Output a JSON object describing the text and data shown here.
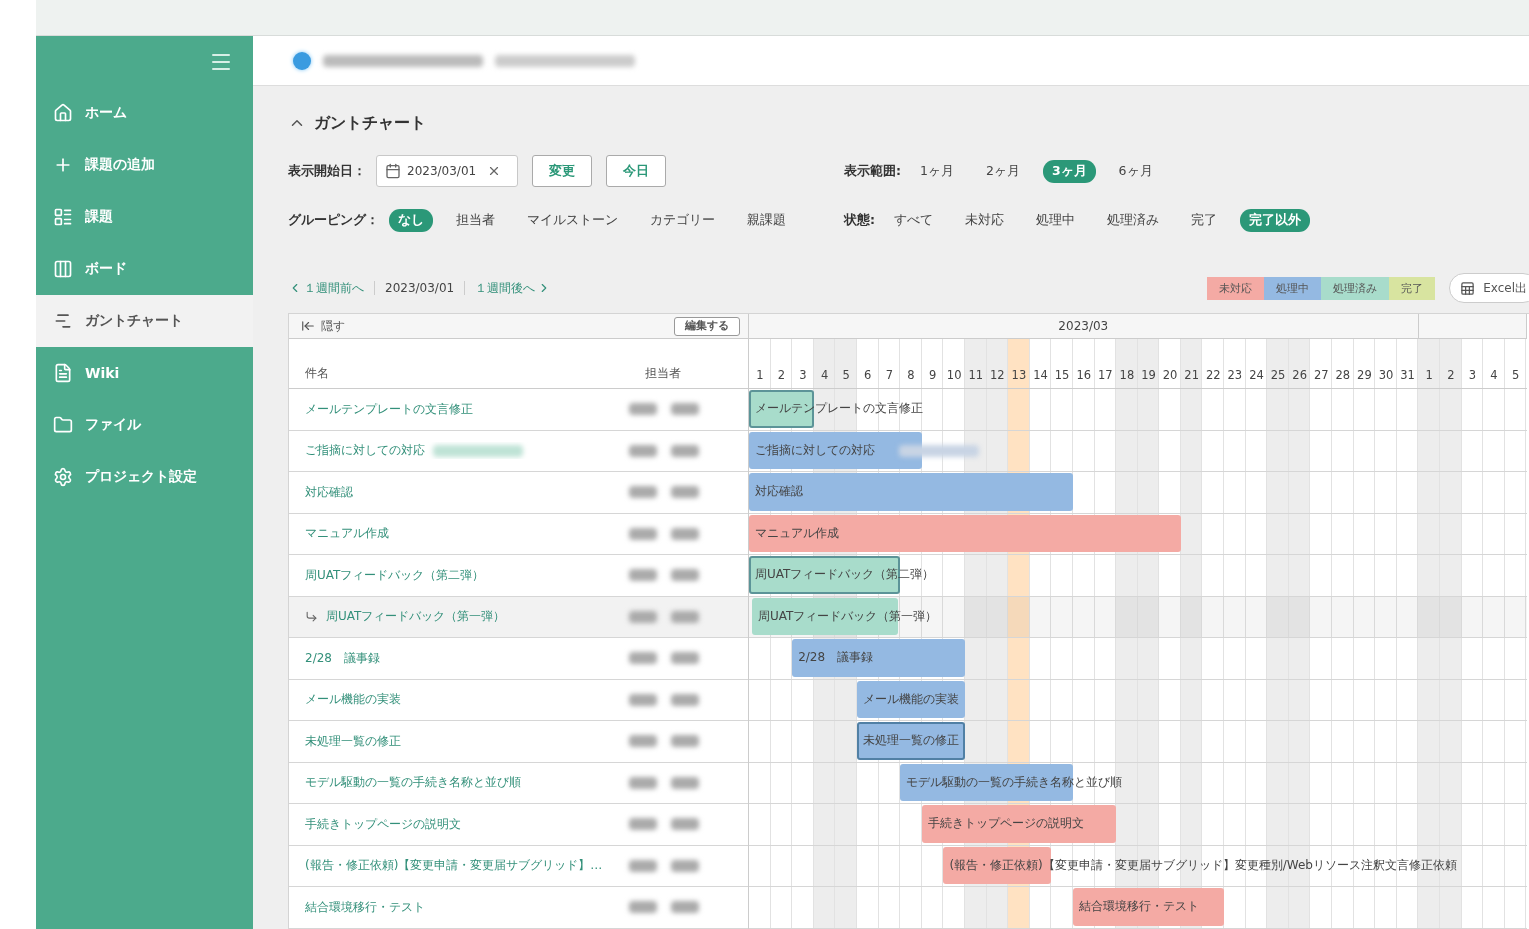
{
  "sidebar": {
    "items": [
      {
        "label": "ホーム",
        "kind": "home",
        "selected": false
      },
      {
        "label": "課題の追加",
        "kind": "add",
        "selected": false
      },
      {
        "label": "課題",
        "kind": "list",
        "selected": false
      },
      {
        "label": "ボード",
        "kind": "board",
        "selected": false
      },
      {
        "label": "ガントチャート",
        "kind": "gantt",
        "selected": true
      },
      {
        "label": "Wiki",
        "kind": "wiki",
        "selected": false
      },
      {
        "label": "ファイル",
        "kind": "file",
        "selected": false
      },
      {
        "label": "プロジェクト設定",
        "kind": "settings",
        "selected": false
      }
    ]
  },
  "section": {
    "title": "ガントチャート"
  },
  "start_date": {
    "label": "表示開始日：",
    "value": "2023/03/01",
    "change_button": "変更",
    "today_button": "今日"
  },
  "range": {
    "label": "表示範囲:",
    "options": [
      {
        "label": "1ヶ月",
        "selected": false
      },
      {
        "label": "2ヶ月",
        "selected": false
      },
      {
        "label": "3ヶ月",
        "selected": true
      },
      {
        "label": "6ヶ月",
        "selected": false
      }
    ]
  },
  "grouping": {
    "label": "グルーピング：",
    "options": [
      {
        "label": "なし",
        "selected": true
      },
      {
        "label": "担当者",
        "selected": false
      },
      {
        "label": "マイルストーン",
        "selected": false
      },
      {
        "label": "カテゴリー",
        "selected": false
      },
      {
        "label": "親課題",
        "selected": false
      }
    ]
  },
  "status_filter": {
    "label": "状態:",
    "options": [
      {
        "label": "すべて",
        "selected": false
      },
      {
        "label": "未対応",
        "selected": false
      },
      {
        "label": "処理中",
        "selected": false
      },
      {
        "label": "処理済み",
        "selected": false
      },
      {
        "label": "完了",
        "selected": false
      },
      {
        "label": "完了以外",
        "selected": true
      }
    ]
  },
  "nav": {
    "prev": "１週間前へ",
    "current": "2023/03/01",
    "next": "１週間後へ"
  },
  "legend": [
    {
      "label": "未対応",
      "color": "#f4aaa4"
    },
    {
      "label": "処理中",
      "color": "#94b9e2"
    },
    {
      "label": "処理済み",
      "color": "#a8dccb"
    },
    {
      "label": "完了",
      "color": "#d8e4a0"
    }
  ],
  "excel_button": "Excel出",
  "chart": {
    "hide": "隠す",
    "edit_button": "編集する",
    "columns": [
      "件名",
      "担当者"
    ],
    "months": [
      {
        "label": "2023/03",
        "days": [
          {
            "label": "1",
            "kind": "weekday"
          },
          {
            "label": "2",
            "kind": "weekday"
          },
          {
            "label": "3",
            "kind": "weekday"
          },
          {
            "label": "4",
            "kind": "holiday"
          },
          {
            "label": "5",
            "kind": "holiday"
          },
          {
            "label": "6",
            "kind": "weekday"
          },
          {
            "label": "7",
            "kind": "weekday"
          },
          {
            "label": "8",
            "kind": "weekday"
          },
          {
            "label": "9",
            "kind": "weekday"
          },
          {
            "label": "10",
            "kind": "weekday"
          },
          {
            "label": "11",
            "kind": "holiday"
          },
          {
            "label": "12",
            "kind": "holiday"
          },
          {
            "label": "13",
            "kind": "today"
          },
          {
            "label": "14",
            "kind": "weekday"
          },
          {
            "label": "15",
            "kind": "weekday"
          },
          {
            "label": "16",
            "kind": "weekday"
          },
          {
            "label": "17",
            "kind": "weekday"
          },
          {
            "label": "18",
            "kind": "holiday"
          },
          {
            "label": "19",
            "kind": "holiday"
          },
          {
            "label": "20",
            "kind": "weekday"
          },
          {
            "label": "21",
            "kind": "holiday"
          },
          {
            "label": "22",
            "kind": "weekday"
          },
          {
            "label": "23",
            "kind": "weekday"
          },
          {
            "label": "24",
            "kind": "weekday"
          },
          {
            "label": "25",
            "kind": "holiday"
          },
          {
            "label": "26",
            "kind": "holiday"
          },
          {
            "label": "27",
            "kind": "weekday"
          },
          {
            "label": "28",
            "kind": "weekday"
          },
          {
            "label": "29",
            "kind": "weekday"
          },
          {
            "label": "30",
            "kind": "weekday"
          },
          {
            "label": "31",
            "kind": "weekday"
          }
        ]
      },
      {
        "days": [
          {
            "label": "1",
            "kind": "holiday"
          },
          {
            "label": "2",
            "kind": "holiday"
          },
          {
            "label": "3",
            "kind": "weekday"
          },
          {
            "label": "4",
            "kind": "weekday"
          },
          {
            "label": "5",
            "kind": "weekday"
          }
        ]
      }
    ],
    "tasks": [
      {
        "title": "メールテンプレートの文言修正",
        "bar_label": "メールテンプレートの文言修正",
        "color": "#a8dccb",
        "highlighted": true,
        "schedule": [
          true,
          true,
          true
        ]
      },
      {
        "title": "ご指摘に対しての対応",
        "bar_label": "ご指摘に対しての対応",
        "color": "#94b9e2",
        "highlighted": false,
        "redacted": true,
        "schedule": [
          true,
          true,
          true,
          true,
          true,
          true,
          true,
          true
        ]
      },
      {
        "title": "対応確認",
        "bar_label": "対応確認",
        "color": "#94b9e2",
        "highlighted": false,
        "schedule": [
          true,
          true,
          true,
          true,
          true,
          true,
          true,
          true,
          true,
          true,
          true,
          true,
          true,
          true,
          true
        ]
      },
      {
        "title": "マニュアル作成",
        "bar_label": "マニュアル作成",
        "color": "#f4aaa4",
        "highlighted": false,
        "schedule": [
          true,
          true,
          true,
          true,
          true,
          true,
          true,
          true,
          true,
          true,
          true,
          true,
          true,
          true,
          true,
          true,
          true,
          true,
          true,
          true
        ]
      },
      {
        "title": "周UATフィードバック（第二弾）",
        "bar_label": "周UATフィードバック（第二弾）",
        "color": "#a8dccb",
        "highlighted": true,
        "schedule": [
          true,
          true,
          true,
          true,
          true,
          true,
          true
        ],
        "children": [
          {
            "title": "周UATフィードバック（第一弾）",
            "bar_label": "周UATフィードバック（第一弾）",
            "color": "#a8dccb",
            "highlighted": false,
            "schedule": [
              true,
              true,
              true,
              true,
              true,
              true,
              true
            ]
          }
        ]
      },
      {
        "title": "2/28　議事録",
        "bar_label": "2/28　議事録",
        "color": "#94b9e2",
        "highlighted": false,
        "schedule": [
          false,
          false,
          true,
          true,
          true,
          true,
          true,
          true,
          true,
          true
        ]
      },
      {
        "title": "メール機能の実装",
        "bar_label": "メール機能の実装",
        "color": "#94b9e2",
        "highlighted": false,
        "schedule": [
          false,
          false,
          false,
          false,
          false,
          true,
          true,
          true,
          true,
          true
        ]
      },
      {
        "title": "未処理一覧の修正",
        "bar_label": "未処理一覧の修正",
        "color": "#94b9e2",
        "highlighted": true,
        "schedule": [
          false,
          false,
          false,
          false,
          false,
          true,
          true,
          true,
          true,
          true
        ]
      },
      {
        "title": "モデル駆動の一覧の手続き名称と並び順",
        "bar_label": "モデル駆動の一覧の手続き名称と並び順",
        "color": "#94b9e2",
        "highlighted": false,
        "schedule": [
          false,
          false,
          false,
          false,
          false,
          false,
          false,
          true,
          true,
          true,
          true,
          true,
          true,
          true,
          true
        ]
      },
      {
        "title": "手続きトップページの説明文",
        "bar_label": "手続きトップページの説明文",
        "color": "#f4aaa4",
        "highlighted": false,
        "schedule": [
          false,
          false,
          false,
          false,
          false,
          false,
          false,
          false,
          true,
          true,
          true,
          true,
          true,
          true,
          true,
          true,
          true
        ]
      },
      {
        "title": "(報告・修正依頼)【変更申請・変更届サブグリッド】…",
        "bar_label": "(報告・修正依頼)【変更申請・変更届サブグリッド】変更種別/Webリソース注釈文言修正依頼",
        "color": "#f4aaa4",
        "highlighted": false,
        "schedule": [
          false,
          false,
          false,
          false,
          false,
          false,
          false,
          false,
          false,
          true,
          true,
          true,
          true,
          true
        ]
      },
      {
        "title": "結合環境移行・テスト",
        "bar_label": "結合環境移行・テスト",
        "color": "#f4aaa4",
        "highlighted": false,
        "schedule": [
          false,
          false,
          false,
          false,
          false,
          false,
          false,
          false,
          false,
          false,
          false,
          false,
          false,
          false,
          false,
          true,
          true,
          true,
          true,
          true,
          true,
          true
        ]
      }
    ]
  }
}
